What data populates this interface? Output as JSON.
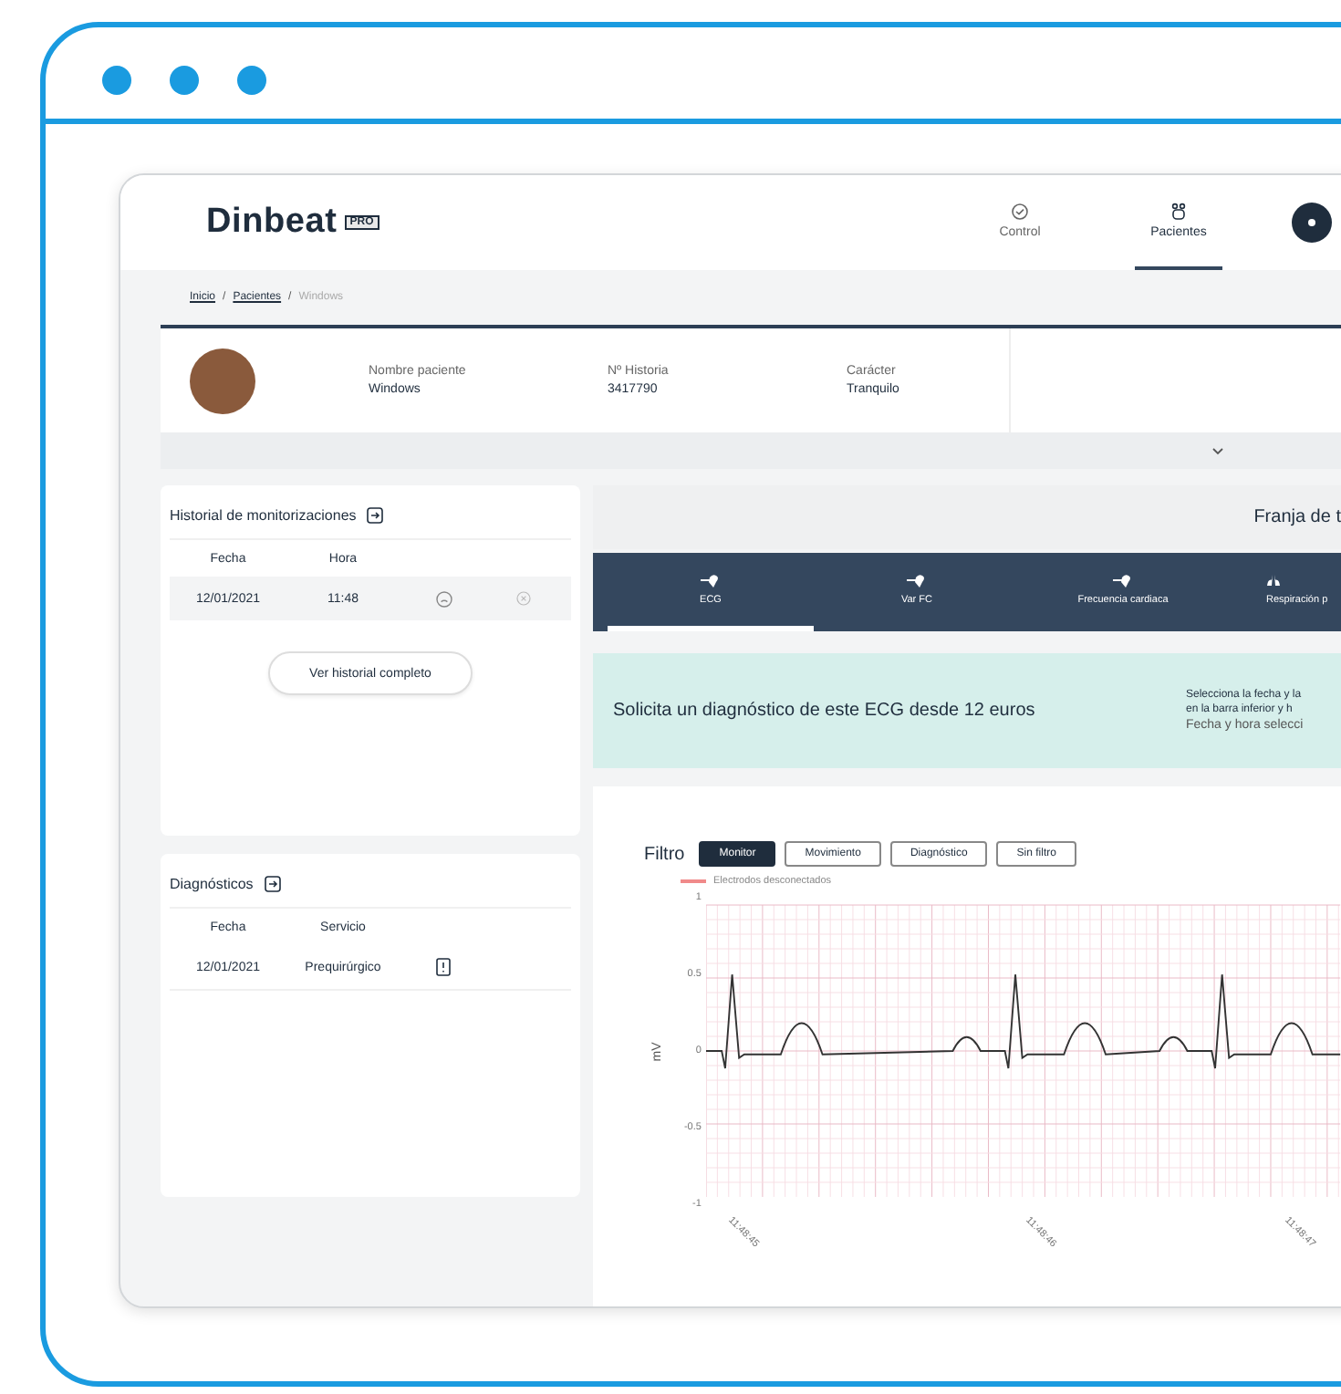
{
  "header": {
    "logo": "Dinbeat",
    "logo_badge": "PRO",
    "nav": [
      {
        "label": "Control",
        "selected": false
      },
      {
        "label": "Pacientes",
        "selected": true
      }
    ]
  },
  "breadcrumb": {
    "separator": "/",
    "items": [
      {
        "label": "Inicio",
        "current": false
      },
      {
        "label": "Pacientes",
        "current": false
      },
      {
        "label": "Windows",
        "current": true
      }
    ]
  },
  "patient": {
    "fields": [
      {
        "label": "Nombre paciente",
        "value": "Windows"
      },
      {
        "label": "Nº Historia",
        "value": "3417790"
      },
      {
        "label": "Carácter",
        "value": "Tranquilo"
      }
    ]
  },
  "history": {
    "title": "Historial de monitorizaciones",
    "columns": [
      "Fecha",
      "Hora"
    ],
    "rows": [
      {
        "date": "12/01/2021",
        "time": "11:48"
      }
    ],
    "button": "Ver historial completo"
  },
  "diagnoses": {
    "title": "Diagnósticos",
    "columns": [
      "Fecha",
      "Servicio"
    ],
    "rows": [
      {
        "date": "12/01/2021",
        "service": "Prequirúrgico"
      }
    ]
  },
  "time_strip": {
    "title": "Franja de t"
  },
  "tabs": [
    {
      "label": "ECG",
      "selected": true
    },
    {
      "label": "Var FC",
      "selected": false
    },
    {
      "label": "Frecuencia cardiaca",
      "selected": false
    },
    {
      "label": "Respiración p",
      "selected": false
    }
  ],
  "banner": {
    "text": "Solicita un diagnóstico de este ECG desde 12 euros",
    "hint_lines": [
      "Selecciona la fecha y la",
      "en la barra inferior y h",
      "Fecha y hora selecci"
    ]
  },
  "filter": {
    "label": "Filtro",
    "options": [
      {
        "label": "Monitor",
        "selected": true
      },
      {
        "label": "Movimiento",
        "selected": false
      },
      {
        "label": "Diagnóstico",
        "selected": false
      },
      {
        "label": "Sin filtro",
        "selected": false
      }
    ]
  },
  "ecg": {
    "legend": "Electrodos desconectados",
    "ylabel": "mV",
    "yticks": [
      "1",
      "0.5",
      "0",
      "-0.5",
      "-1"
    ],
    "xticks": [
      "11:48:45",
      "11:48:46",
      "11:48:47"
    ]
  }
}
